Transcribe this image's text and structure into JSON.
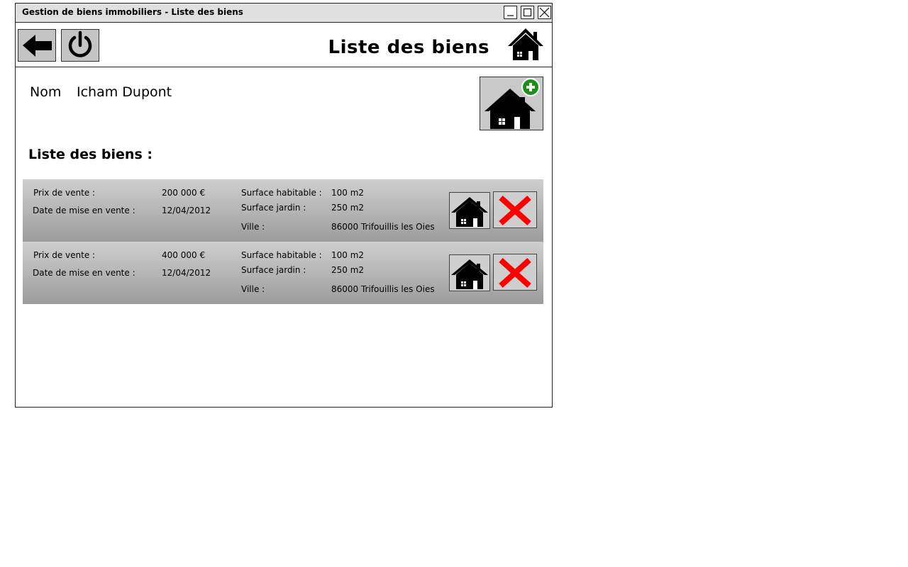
{
  "window": {
    "title": "Gestion de biens immobiliers - Liste des biens"
  },
  "header": {
    "page_title": "Liste des biens"
  },
  "owner": {
    "label": "Nom",
    "value": "Icham Dupont"
  },
  "list": {
    "title": "Liste des biens :",
    "labels": {
      "price": "Prix de vente :",
      "date": "Date de mise en vente :",
      "surface_habitable": "Surface habitable :",
      "surface_jardin": "Surface jardin :",
      "ville": "Ville :"
    },
    "items": [
      {
        "price": "200 000 €",
        "date": "12/04/2012",
        "surface_habitable": "100 m2",
        "surface_jardin": "250 m2",
        "ville": "86000 Trifouillis les Oies"
      },
      {
        "price": "400 000 €",
        "date": "12/04/2012",
        "surface_habitable": "100 m2",
        "surface_jardin": "250 m2",
        "ville": "86000 Trifouillis les Oies"
      }
    ]
  },
  "icons": {
    "back": "arrow-left-icon",
    "power": "power-icon",
    "home": "house-icon",
    "add_home": "house-plus-icon",
    "delete": "red-x-icon"
  },
  "colors": {
    "delete": "#ff0000",
    "add": "#1a8f1a",
    "row_gradient_top": "#cfcfcf",
    "row_gradient_bottom": "#9c9c9c"
  }
}
